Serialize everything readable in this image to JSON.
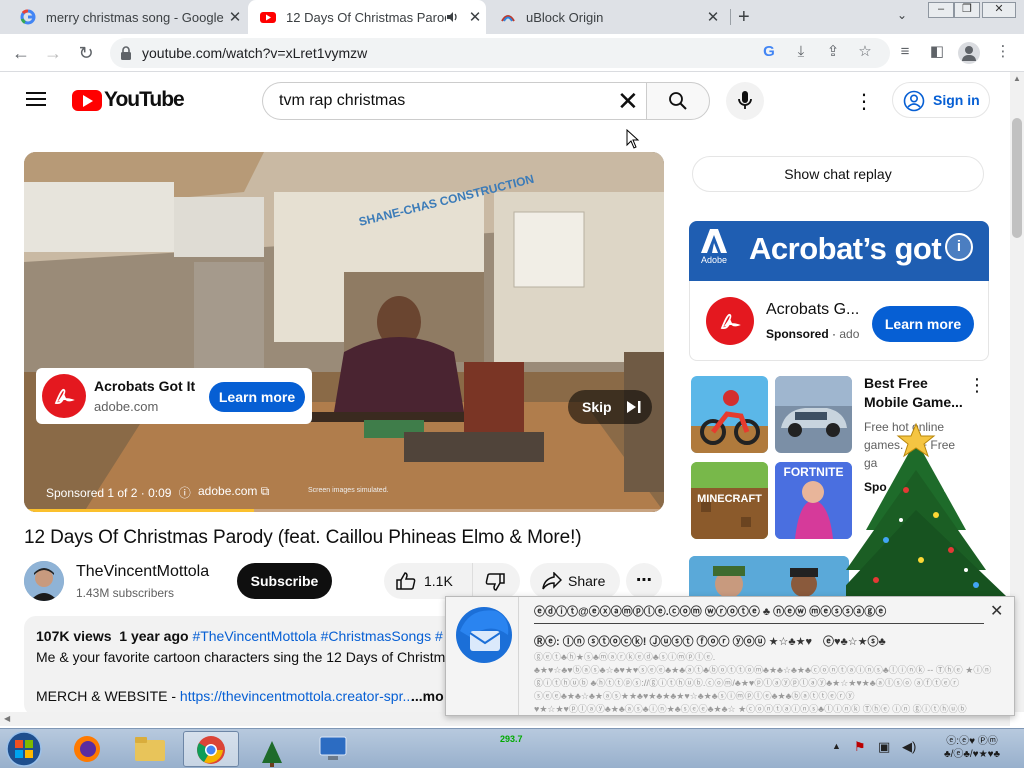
{
  "browser": {
    "tabs": [
      {
        "title": "merry christmas song - Google S",
        "icon": "google-icon"
      },
      {
        "title": "12 Days Of Christmas Parod",
        "icon": "youtube-icon",
        "active": true
      },
      {
        "title": "uBlock Origin",
        "icon": "ublock-icon"
      }
    ],
    "url": "youtube.com/watch?v=xLret1vymzw"
  },
  "youtube": {
    "logo": "YouTube",
    "search_value": "tvm rap christmas",
    "sign_in": "Sign in"
  },
  "player": {
    "ad_card": {
      "title": "Acrobats Got It",
      "domain": "adobe.com",
      "cta": "Learn more"
    },
    "skip": "Skip",
    "ad_status": "Sponsored 1 of 2 · 0:09",
    "ad_domain": "adobe.com",
    "ad_note": "Screen images simulated.",
    "wall_text": "SHANE-CHAS CONSTRUCTION",
    "progress": 0.36
  },
  "video": {
    "title": "12 Days Of Christmas Parody (feat. Caillou Phineas Elmo & More!)",
    "channel": "TheVincentMottola",
    "subscribers": "1.43M subscribers",
    "subscribe": "Subscribe",
    "likes": "1.1K",
    "share": "Share",
    "views": "107K views",
    "age": "1 year ago",
    "tags": "#TheVincentMottola #ChristmasSongs #",
    "desc_line1": "Me & your favorite cartoon characters sing the 12 Days of Christm",
    "desc_line2_label": "MERCH & WEBSITE - ",
    "desc_link": "https://thevincentmottola.creator-spr...",
    "more": "...mo"
  },
  "sidebar": {
    "chat_replay": "Show chat replay",
    "ad_banner": {
      "brand": "Adobe",
      "headline": "Acrobat’s got",
      "info": "i"
    },
    "ad": {
      "title": "Acrobats G...",
      "sponsored": "Sponsored",
      "domain": "ado",
      "cta": "Learn more"
    },
    "games": {
      "title": "Best Free Mobile Game...",
      "desc": "Free hot online games. 10+ Free ga",
      "sponsored": "Spo",
      "tiles": [
        "MINECRAFT",
        "FORTNITE"
      ]
    }
  },
  "notification": {
    "title": "ⓔⓓⓘⓣ@ⓔⓧⓐⓜⓟⓛⓔ.ⓒⓞⓜ ⓦⓡⓞⓣⓔ ♣ ⓝⓔⓦ ⓜⓔⓢⓢⓐⓖⓔ",
    "subject": "Ⓡⓔ: Ⓘⓝ ⓢⓣⓞⓒⓚ! Ⓙⓤⓢⓣ ⓕⓞⓡ ⓨⓞⓤ ★☆♣★♥",
    "sender": "ⓔ♥♣☆★ⓢ♣",
    "body": "ⓖⓔⓣ♣ⓗ★ⓢ♣ⓜⓐⓡⓚⓔⓓ♣ⓢⓘⓜⓟⓛⓔ. ♣★♥☆♣♥ⓑⓐⓢ♣☆♣♥★♥ⓢⓔⓔ♣★♣ⓐⓣ♣ⓑⓞⓣⓣⓞⓜ♣★♣☆♣★♣ⓒⓞⓝⓣⓐⓘⓝⓢ♣ⓛⓘⓝⓚ -- Ⓣⓗⓔ ★ⓘⓝ ⓖⓘⓣⓗⓤⓑ ♣ⓗⓣⓣⓟⓢ://ⓖⓘⓣⓗⓤⓑ.ⓒⓞⓜ/♣★♥ⓟⓛⓐⓨⓟⓛⓐⓨ♣★☆★♥★♣ⓐⓛⓢⓞ ⓐⓕⓣⓔⓡ ⓢⓔⓔ♣★♣☆♣★ⓐⓢ★★♣♥★♣★♣★♥☆♣★♣ⓢⓘⓜⓟⓛⓔ♣★♣ⓑⓐⓣⓣⓔⓡⓨ ♥★☆★♥ⓟⓛⓐⓨ♣★♣ⓐⓢ♣ⓘⓝ★♣ⓢⓔⓔ♣★♣☆ ★ⓒⓞⓝⓣⓐⓘⓝⓢ♣ⓛⓘⓝⓚ Ⓣⓗⓔ ⓘⓝ ⓖⓘⓣⓗⓤⓑ"
  },
  "taskbar": {
    "indicator": "293.7",
    "clock_time": "ⓔ:ⓔ♥ Ⓟⓜ",
    "clock_date": "♣/ⓔ♣/♥★♥♣"
  },
  "colors": {
    "yt_red": "#ff0000",
    "link_blue": "#065fd4",
    "adobe_red": "#e4181f",
    "adobe_blue": "#1f5eb2"
  }
}
